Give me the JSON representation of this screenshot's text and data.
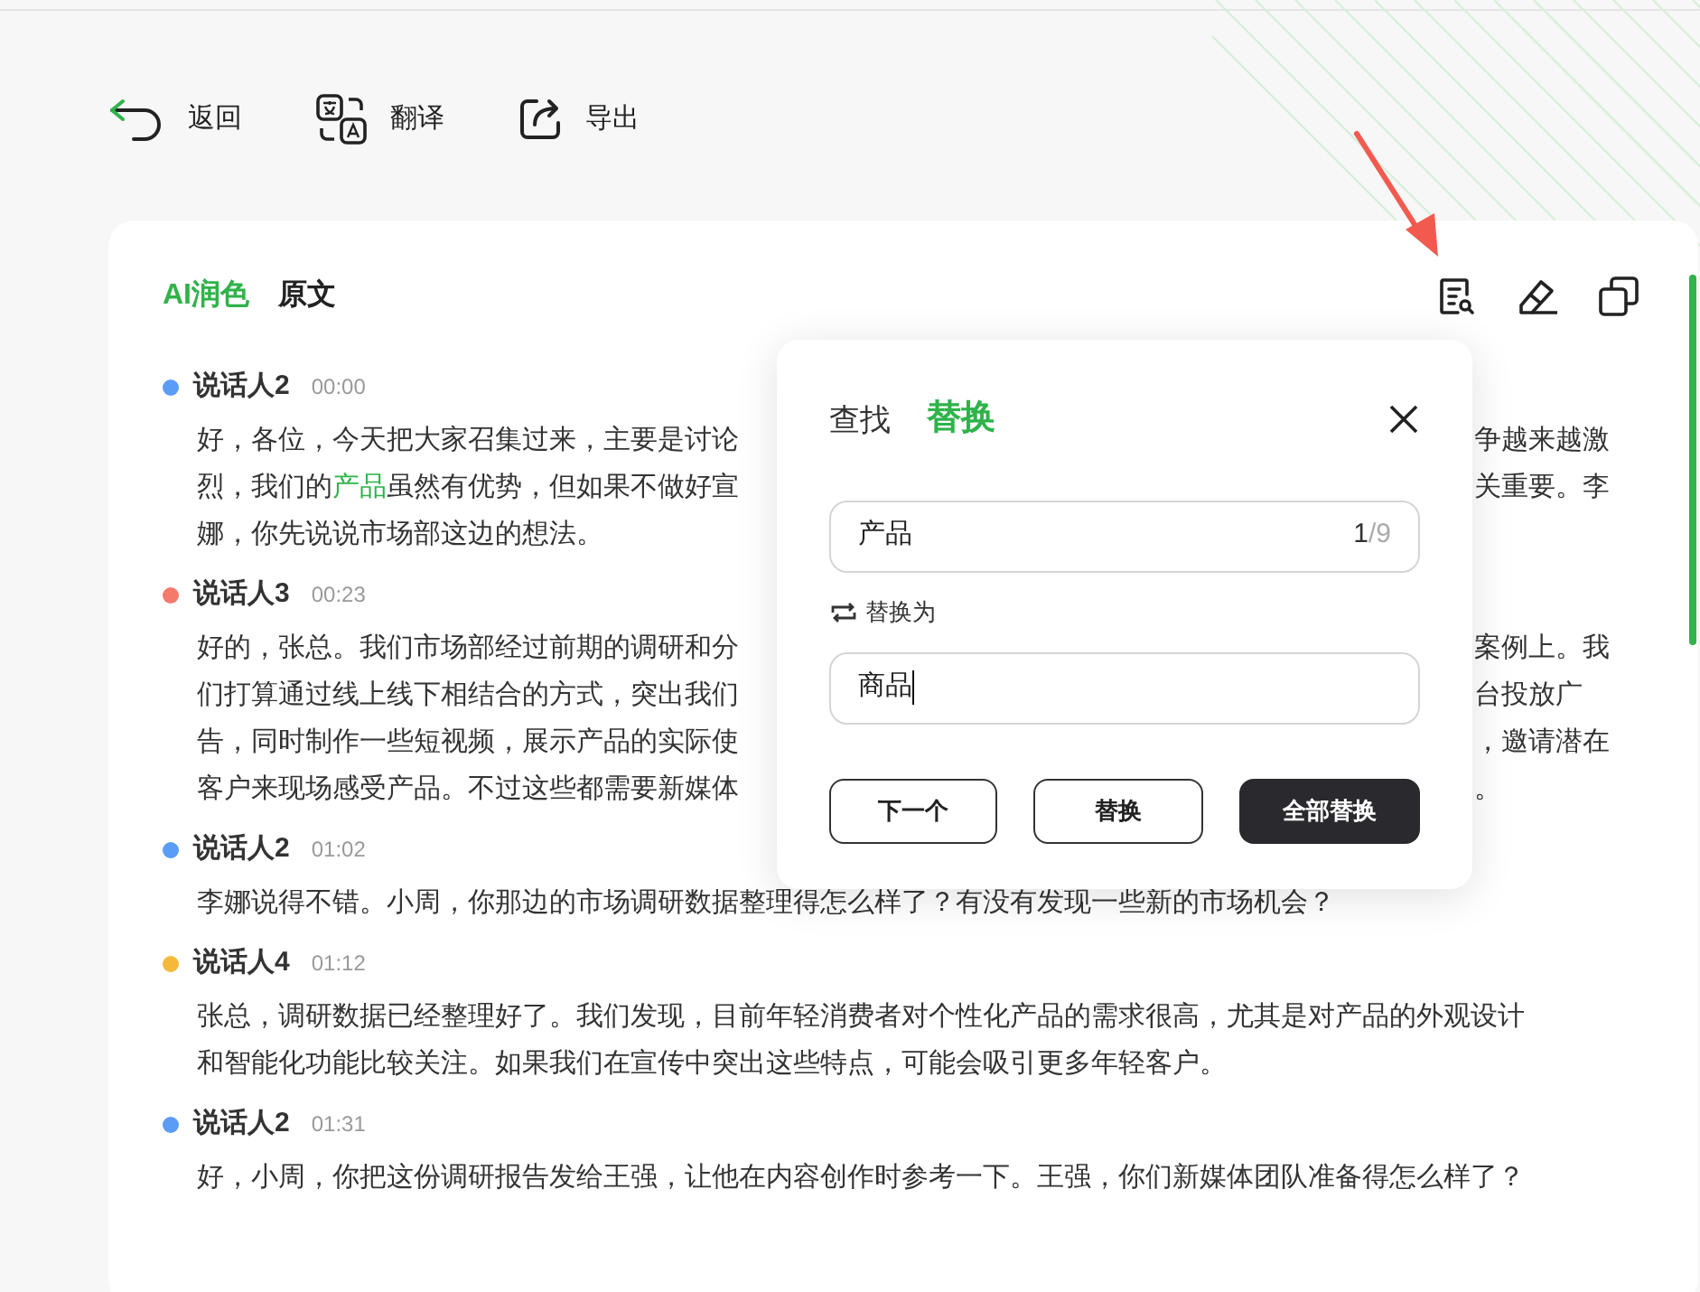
{
  "toolbar": [
    {
      "kind": "back",
      "label": "返回"
    },
    {
      "kind": "translate",
      "label": "翻译"
    },
    {
      "kind": "export",
      "label": "导出"
    }
  ],
  "tabs": [
    {
      "label": "AI润色",
      "selected": true
    },
    {
      "label": "原文",
      "selected": false
    }
  ],
  "messages": [
    {
      "speaker": "说话人2",
      "time": "00:00",
      "color": "#5b9cf6",
      "lines": [
        {
          "segments": [
            {
              "text": "好，各位，今天把大家召集过来，主要是讨论",
              "highlighted": false
            }
          ],
          "right": "争越来越激"
        },
        {
          "segments": [
            {
              "text": "烈，我们的",
              "highlighted": false
            },
            {
              "text": "产品",
              "highlighted": true
            },
            {
              "text": "虽然有优势，但如果不做好宣",
              "highlighted": false
            }
          ],
          "right": "关重要。李"
        },
        {
          "segments": [
            {
              "text": "娜，你先说说市场部这边的想法。",
              "highlighted": false
            }
          ]
        }
      ]
    },
    {
      "speaker": "说话人3",
      "time": "00:23",
      "color": "#f57a6c",
      "lines": [
        {
          "segments": [
            {
              "text": "好的，张总。我们市场部经过前期的调研和分",
              "highlighted": false
            }
          ],
          "right": "案例上。我"
        },
        {
          "segments": [
            {
              "text": "们打算通过线上线下相结合的方式，突出我们",
              "highlighted": false
            }
          ],
          "right": "台投放广"
        },
        {
          "segments": [
            {
              "text": "告，同时制作一些短视频，展示产品的实际使",
              "highlighted": false
            }
          ],
          "right": "，邀请潜在"
        },
        {
          "segments": [
            {
              "text": "客户来现场感受产品。不过这些都需要新媒体",
              "highlighted": false
            }
          ],
          "right": "。"
        }
      ]
    },
    {
      "speaker": "说话人2",
      "time": "01:02",
      "color": "#5b9cf6",
      "lines": [
        {
          "segments": [
            {
              "text": "李娜说得不错。小周，你那边的市场调研数据整理得怎么样了？有没有发现一些新的市场机会？",
              "highlighted": false
            }
          ]
        }
      ]
    },
    {
      "speaker": "说话人4",
      "time": "01:12",
      "color": "#f5b93a",
      "lines": [
        {
          "segments": [
            {
              "text": "张总，调研数据已经整理好了。我们发现，目前年轻消费者对个性化产品的需求很高，尤其是对产品的外观设计",
              "highlighted": false
            }
          ]
        },
        {
          "segments": [
            {
              "text": "和智能化功能比较关注。如果我们在宣传中突出这些特点，可能会吸引更多年轻客户。",
              "highlighted": false
            }
          ]
        }
      ]
    },
    {
      "speaker": "说话人2",
      "time": "01:31",
      "color": "#5b9cf6",
      "lines": [
        {
          "segments": [
            {
              "text": "好，小周，你把这份调研报告发给王强，让他在内容创作时参考一下。王强，你们新媒体团队准备得怎么样了？",
              "highlighted": false
            }
          ]
        }
      ]
    }
  ],
  "dialog": {
    "tabs": [
      {
        "label": "查找",
        "selected": false
      },
      {
        "label": "替换",
        "selected": true
      }
    ],
    "find": {
      "value": "产品",
      "current": "1",
      "total": "/9"
    },
    "replace_label": "替换为",
    "replace": {
      "value": "商品"
    },
    "buttons": [
      {
        "kind": "outline",
        "label": "下一个"
      },
      {
        "kind": "outline",
        "label": "替换"
      },
      {
        "kind": "primary",
        "label": "全部替换"
      }
    ]
  }
}
